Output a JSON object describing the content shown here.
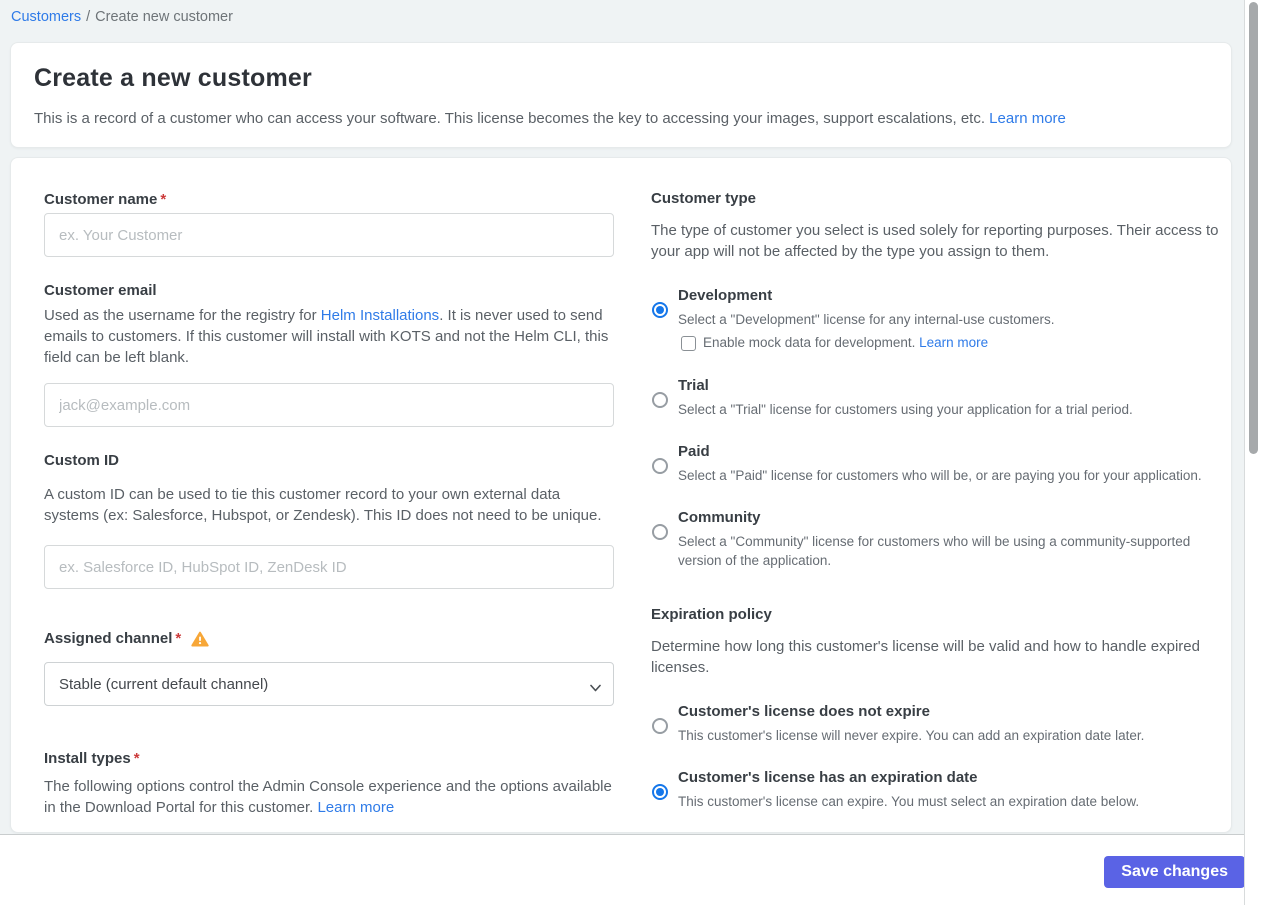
{
  "breadcrumb": {
    "link": "Customers",
    "separator": "/",
    "current": "Create new customer"
  },
  "header": {
    "title": "Create a new customer",
    "description": "This is a record of a customer who can access your software. This license becomes the key to accessing your images, support escalations, etc.",
    "learn_more": "Learn more"
  },
  "form": {
    "customer_name": {
      "label": "Customer name",
      "required": "*",
      "placeholder": "ex. Your Customer"
    },
    "customer_email": {
      "label": "Customer email",
      "help_before": "Used as the username for the registry for ",
      "help_link": "Helm Installations",
      "help_after": ". It is never used to send emails to customers. If this customer will install with KOTS and not the Helm CLI, this field can be left blank.",
      "placeholder": "jack@example.com"
    },
    "custom_id": {
      "label": "Custom ID",
      "help": "A custom ID can be used to tie this customer record to your own external data systems (ex: Salesforce, Hubspot, or Zendesk). This ID does not need to be unique.",
      "placeholder": "ex. Salesforce ID, HubSpot ID, ZenDesk ID"
    },
    "assigned_channel": {
      "label": "Assigned channel",
      "required": "*",
      "selected_option": "Stable (current default channel)"
    },
    "install_types": {
      "label": "Install types",
      "required": "*",
      "help": "The following options control the Admin Console experience and the options available in the Download Portal for this customer.",
      "learn_more": "Learn more"
    }
  },
  "customer_type": {
    "heading": "Customer type",
    "description": "The type of customer you select is used solely for reporting purposes. Their access to your app will not be affected by the type you assign to them.",
    "options": [
      {
        "title": "Development",
        "description": "Select a \"Development\" license for any internal-use customers.",
        "selected": true,
        "checkbox": {
          "label": "Enable mock data for development.",
          "learn_more": "Learn more",
          "checked": false
        }
      },
      {
        "title": "Trial",
        "description": "Select a \"Trial\" license for customers using your application for a trial period.",
        "selected": false
      },
      {
        "title": "Paid",
        "description": "Select a \"Paid\" license for customers who will be, or are paying you for your application.",
        "selected": false
      },
      {
        "title": "Community",
        "description": "Select a \"Community\" license for customers who will be using a community-supported version of the application.",
        "selected": false
      }
    ]
  },
  "expiration_policy": {
    "heading": "Expiration policy",
    "description": "Determine how long this customer's license will be valid and how to handle expired licenses.",
    "options": [
      {
        "title": "Customer's license does not expire",
        "description": "This customer's license will never expire. You can add an expiration date later.",
        "selected": false
      },
      {
        "title": "Customer's license has an expiration date",
        "description": "This customer's license can expire. You must select an expiration date below.",
        "selected": true
      }
    ]
  },
  "footer": {
    "save_label": "Save changes"
  },
  "colors": {
    "page_background": "#eff3f4",
    "accent_link": "#2f7be8",
    "radio_selected": "#1577ea",
    "save_button": "#5a63e5",
    "warning_icon": "#f7a738",
    "required_asterisk": "#cc3b3b"
  }
}
